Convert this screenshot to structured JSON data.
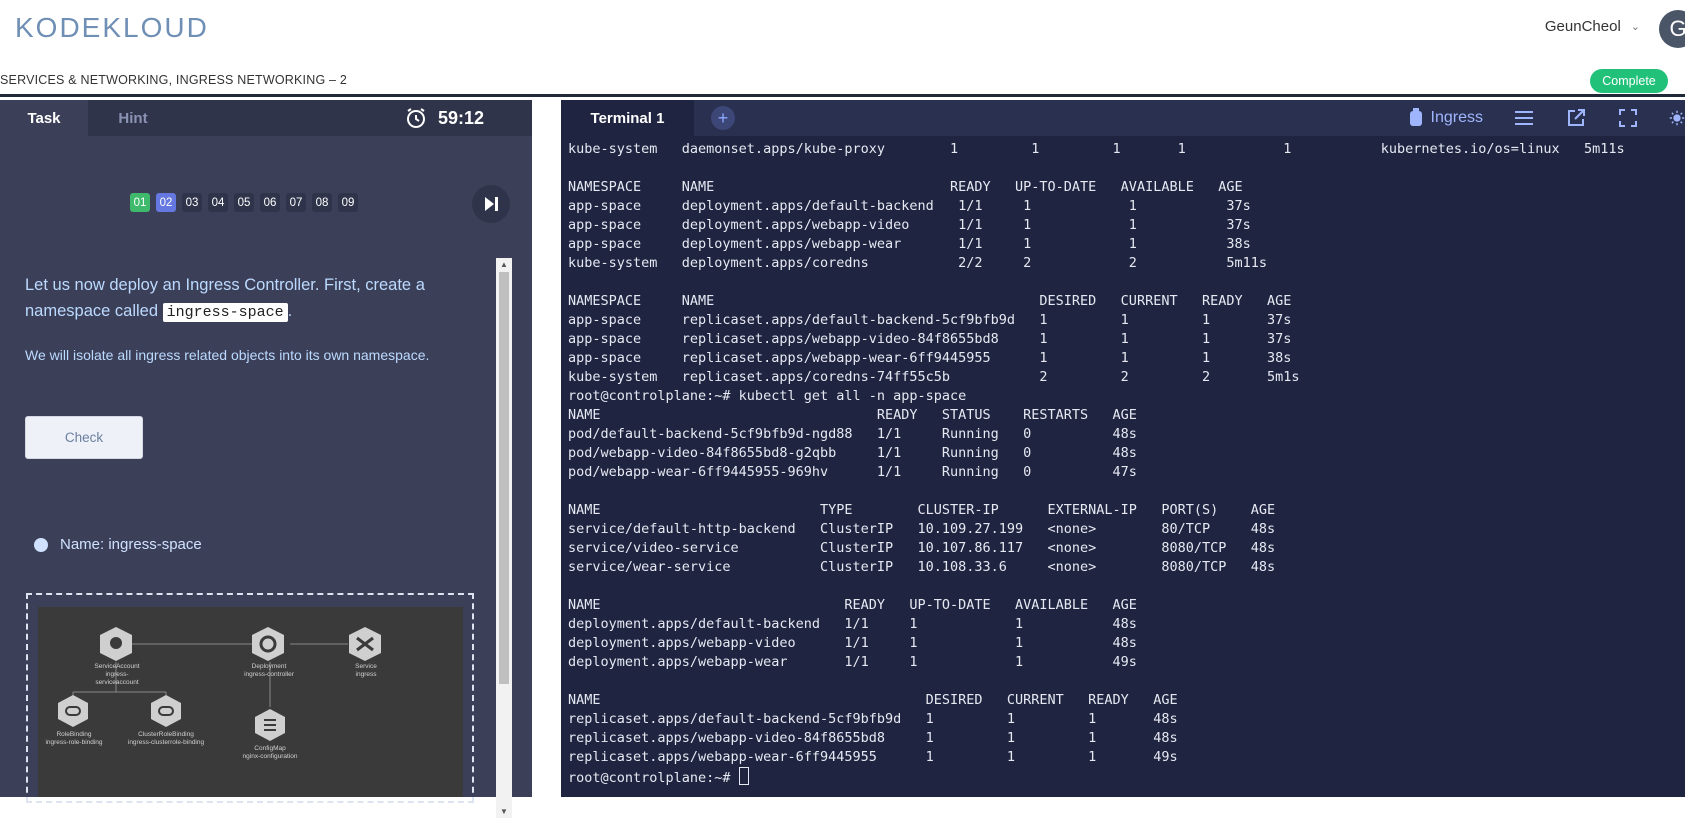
{
  "header": {
    "logo_text": "KODEKLOUD",
    "user_name": "GeunCheol",
    "avatar_letter": "G",
    "breadcrumb": "SERVICES & NETWORKING, INGRESS NETWORKING – 2",
    "complete_label": "Complete"
  },
  "task_panel": {
    "tabs": {
      "task": "Task",
      "hint": "Hint"
    },
    "timer": "59:12",
    "questions": [
      {
        "label": "01",
        "state": "done"
      },
      {
        "label": "02",
        "state": "active"
      },
      {
        "label": "03",
        "state": "pending"
      },
      {
        "label": "04",
        "state": "pending"
      },
      {
        "label": "05",
        "state": "pending"
      },
      {
        "label": "06",
        "state": "pending"
      },
      {
        "label": "07",
        "state": "pending"
      },
      {
        "label": "08",
        "state": "pending"
      },
      {
        "label": "09",
        "state": "pending"
      }
    ],
    "instruction_before": "Let us now deploy an Ingress Controller. First, create a namespace called ",
    "instruction_code": "ingress-space",
    "instruction_after": ".",
    "sub_text": "We will isolate all ingress related objects into its own namespace.",
    "check_label": "Check",
    "criteria": "Name: ingress-space",
    "diagram_labels": {
      "sa": "ServiceAccount\ningress-serviceaccount",
      "deploy": "Deployment\ningress-controller",
      "svc": "Service\ningress",
      "rb": "RoleBinding\ningress-role-binding",
      "crb": "ClusterRoleBinding\ningress-clusterrole-binding",
      "cm": "ConfigMap\nnginx-configuration"
    }
  },
  "terminal": {
    "tab_label": "Terminal 1",
    "add_tab_symbol": "+",
    "context_label": "Ingress",
    "lines": [
      "kube-system   daemonset.apps/kube-proxy        1         1         1       1            1           kubernetes.io/os=linux   5m11s",
      "",
      "NAMESPACE     NAME                             READY   UP-TO-DATE   AVAILABLE   AGE",
      "app-space     deployment.apps/default-backend   1/1     1            1           37s",
      "app-space     deployment.apps/webapp-video      1/1     1            1           37s",
      "app-space     deployment.apps/webapp-wear       1/1     1            1           38s",
      "kube-system   deployment.apps/coredns           2/2     2            2           5m11s",
      "",
      "NAMESPACE     NAME                                        DESIRED   CURRENT   READY   AGE",
      "app-space     replicaset.apps/default-backend-5cf9bfb9d   1         1         1       37s",
      "app-space     replicaset.apps/webapp-video-84f8655bd8     1         1         1       37s",
      "app-space     replicaset.apps/webapp-wear-6ff9445955      1         1         1       38s",
      "kube-system   replicaset.apps/coredns-74ff55c5b           2         2         2       5m1s",
      "root@controlplane:~# kubectl get all -n app-space",
      "NAME                                  READY   STATUS    RESTARTS   AGE",
      "pod/default-backend-5cf9bfb9d-ngd88   1/1     Running   0          48s",
      "pod/webapp-video-84f8655bd8-g2qbb     1/1     Running   0          48s",
      "pod/webapp-wear-6ff9445955-969hv      1/1     Running   0          47s",
      "",
      "NAME                           TYPE        CLUSTER-IP      EXTERNAL-IP   PORT(S)    AGE",
      "service/default-http-backend   ClusterIP   10.109.27.199   <none>        80/TCP     48s",
      "service/video-service          ClusterIP   10.107.86.117   <none>        8080/TCP   48s",
      "service/wear-service           ClusterIP   10.108.33.6     <none>        8080/TCP   48s",
      "",
      "NAME                              READY   UP-TO-DATE   AVAILABLE   AGE",
      "deployment.apps/default-backend   1/1     1            1           48s",
      "deployment.apps/webapp-video      1/1     1            1           48s",
      "deployment.apps/webapp-wear       1/1     1            1           49s",
      "",
      "NAME                                        DESIRED   CURRENT   READY   AGE",
      "replicaset.apps/default-backend-5cf9bfb9d   1         1         1       48s",
      "replicaset.apps/webapp-video-84f8655bd8     1         1         1       48s",
      "replicaset.apps/webapp-wear-6ff9445955      1         1         1       49s"
    ],
    "prompt": "root@controlplane:~# "
  },
  "colors": {
    "panel_bg": "#3b4058",
    "terminal_bg": "#1f2440",
    "complete_green": "#22c17a",
    "active_question": "#6577e0",
    "done_question": "#3fb96b",
    "accent_text": "#bcd9ff"
  }
}
